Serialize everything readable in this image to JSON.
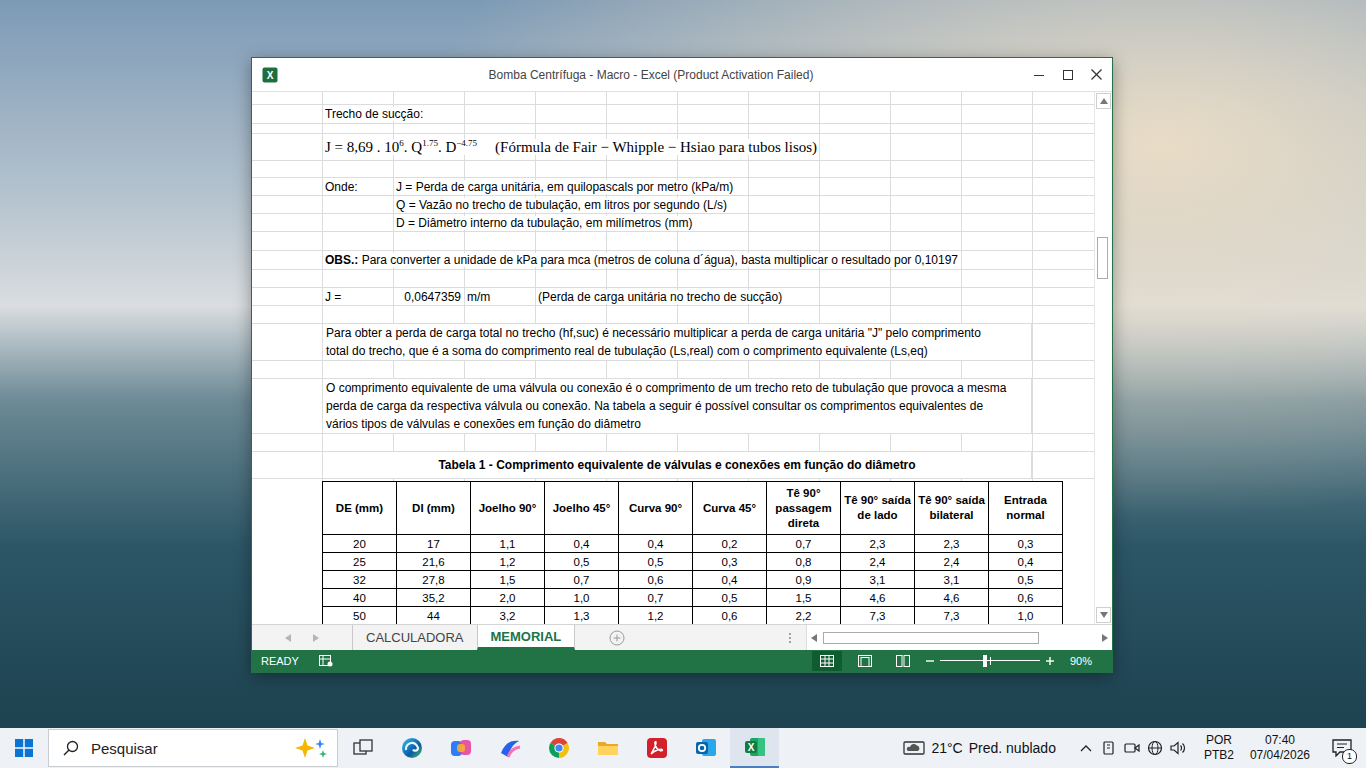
{
  "window": {
    "title": "Bomba Centrífuga - Macro - Excel (Product Activation Failed)",
    "icon_letter": "X"
  },
  "sheet": {
    "section_title": "Trecho de sucção:",
    "formula": {
      "parts": [
        {
          "text": "J = 8,69 . 10",
          "sup": "6"
        },
        {
          "text": ". Q",
          "sup": "1.75"
        },
        {
          "text": ". D",
          "sup": "−4.75"
        }
      ],
      "note": "(Fórmula de Fair − Whipple − Hsiao para tubos lisos)"
    },
    "where_label": "Onde:",
    "definitions": [
      "J = Perda de carga unitária, em quilopascals por metro (kPa/m)",
      "Q = Vazão no trecho de tubulação, em litros por segundo (L/s)",
      "D = Diâmetro interno da tubulação, em milímetros (mm)"
    ],
    "obs": {
      "label": "OBS.:",
      "text": "Para converter a unidade de kPa para mca (metros de coluna d´água), basta multiplicar o resultado por 0,10197"
    },
    "result": {
      "label": "J =",
      "value": "0,0647359",
      "unit": "m/m",
      "note": "(Perda de carga unitária no trecho de sucção)"
    },
    "paragraphs": [
      [
        "Para obter a perda de carga total no trecho (hf,suc) é necessário multiplicar a perda de carga unitária \"J\" pelo comprimento",
        "total do trecho, que é a soma do comprimento real de tubulação (Ls,real) com o comprimento equivalente (Ls,eq)"
      ],
      [
        "O comprimento equivalente de uma válvula ou conexão é o comprimento de um trecho reto de tubulação que provoca a mesma",
        "perda de carga da respectiva válvula ou conexão. Na tabela a seguir é possível consultar os comprimentos equivalentes de",
        "vários tipos de válvulas e conexões em função do diâmetro"
      ]
    ],
    "table": {
      "title": "Tabela 1 - Comprimento equivalente de válvulas e conexões em função do diâmetro",
      "columns": [
        "DE (mm)",
        "DI (mm)",
        "Joelho 90°",
        "Joelho 45°",
        "Curva 90°",
        "Curva 45°",
        "Tê 90° passagem direta",
        "Tê 90° saída de lado",
        "Tê 90° saída bilateral",
        "Entrada normal"
      ],
      "rows": [
        [
          "20",
          "17",
          "1,1",
          "0,4",
          "0,4",
          "0,2",
          "0,7",
          "2,3",
          "2,3",
          "0,3"
        ],
        [
          "25",
          "21,6",
          "1,2",
          "0,5",
          "0,5",
          "0,3",
          "0,8",
          "2,4",
          "2,4",
          "0,4"
        ],
        [
          "32",
          "27,8",
          "1,5",
          "0,7",
          "0,6",
          "0,4",
          "0,9",
          "3,1",
          "3,1",
          "0,5"
        ],
        [
          "40",
          "35,2",
          "2,0",
          "1,0",
          "0,7",
          "0,5",
          "1,5",
          "4,6",
          "4,6",
          "0,6"
        ],
        [
          "50",
          "44",
          "3,2",
          "1,3",
          "1,2",
          "0,6",
          "2,2",
          "7,3",
          "7,3",
          "1,0"
        ]
      ]
    }
  },
  "vertical_scroll": {
    "position": 0.28
  },
  "sheet_tabs": [
    {
      "label": "CALCULADORA",
      "selected": false
    },
    {
      "label": "MEMORIAL",
      "selected": true
    }
  ],
  "horizontal_scroll": {
    "position": 0.01
  },
  "status_bar": {
    "mode": "READY",
    "views": [
      {
        "kind": "normal",
        "selected": true
      },
      {
        "kind": "page_layout",
        "selected": false
      },
      {
        "kind": "page_break",
        "selected": false
      }
    ],
    "zoom": {
      "level": 0.45,
      "reading": "90%"
    }
  },
  "taskbar": {
    "search_placeholder": "Pesquisar",
    "apps": [
      {
        "kind": "taskview",
        "active": false
      },
      {
        "kind": "edge",
        "active": false
      },
      {
        "kind": "copilot",
        "active": false
      },
      {
        "kind": "photos",
        "active": false
      },
      {
        "kind": "chrome",
        "active": false
      },
      {
        "kind": "explorer",
        "active": false
      },
      {
        "kind": "acrobat",
        "active": false
      },
      {
        "kind": "outlook",
        "active": false
      },
      {
        "kind": "excel",
        "active": true
      }
    ],
    "excel_letter": "X",
    "weather": {
      "temperature": "21°C",
      "condition": "Pred. nublado"
    },
    "tray": [
      {
        "kind": "pen"
      },
      {
        "kind": "meet"
      },
      {
        "kind": "network"
      },
      {
        "kind": "volume"
      }
    ],
    "language": {
      "line1": "POR",
      "line2": "PTB2"
    },
    "clock": {
      "time": "07:40",
      "date": "07/04/2026"
    },
    "notifications": "1"
  }
}
